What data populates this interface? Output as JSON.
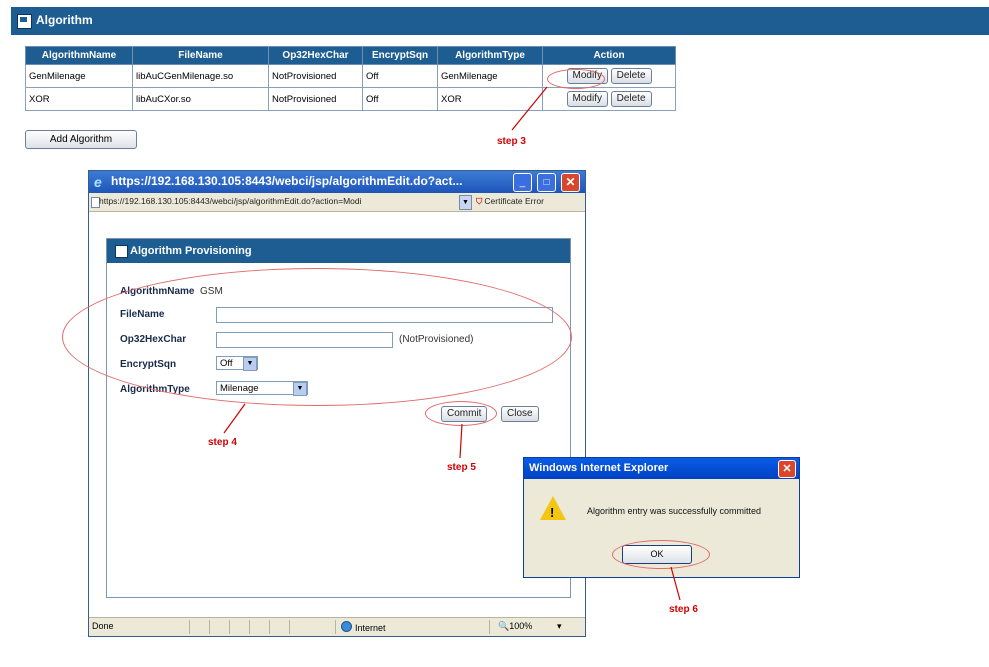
{
  "header": {
    "title": "Algorithm"
  },
  "table": {
    "columns": [
      "AlgorithmName",
      "FileName",
      "Op32HexChar",
      "EncryptSqn",
      "AlgorithmType",
      "Action"
    ],
    "rows": [
      [
        "GenMilenage",
        "libAuCGenMilenage.so",
        "NotProvisioned",
        "Off",
        "GenMilenage"
      ],
      [
        "XOR",
        "libAuCXor.so",
        "NotProvisioned",
        "Off",
        "XOR"
      ]
    ],
    "modify_label": "Modify",
    "delete_label": "Delete"
  },
  "add_button": "Add Algorithm",
  "annotations": {
    "step3": "step 3",
    "step4": "step 4",
    "step5": "step 5",
    "step6": "step 6"
  },
  "popup": {
    "title": "https://192.168.130.105:8443/webci/jsp/algorithmEdit.do?act...",
    "address": "https://192.168.130.105:8443/webci/jsp/algorithmEdit.do?action=Modi",
    "cert_error": "Certificate Error",
    "panel_title": "Algorithm Provisioning",
    "fields": {
      "algorithm_name_label": "AlgorithmName",
      "algorithm_name_value": "GSM",
      "filename_label": "FileName",
      "filename_value": "",
      "op32_label": "Op32HexChar",
      "op32_value": "",
      "op32_hint": "(NotProvisioned)",
      "encrypt_label": "EncryptSqn",
      "encrypt_value": "Off",
      "type_label": "AlgorithmType",
      "type_value": "Milenage"
    },
    "commit_label": "Commit",
    "close_label": "Close",
    "status": {
      "done": "Done",
      "zone": "Internet",
      "zoom": "100%"
    }
  },
  "dialog": {
    "title": "Windows Internet Explorer",
    "message": "Algorithm entry was successfully committed",
    "ok_label": "OK"
  },
  "colors": {
    "header_blue": "#1d5d92",
    "annotation_red": "#d00000"
  }
}
